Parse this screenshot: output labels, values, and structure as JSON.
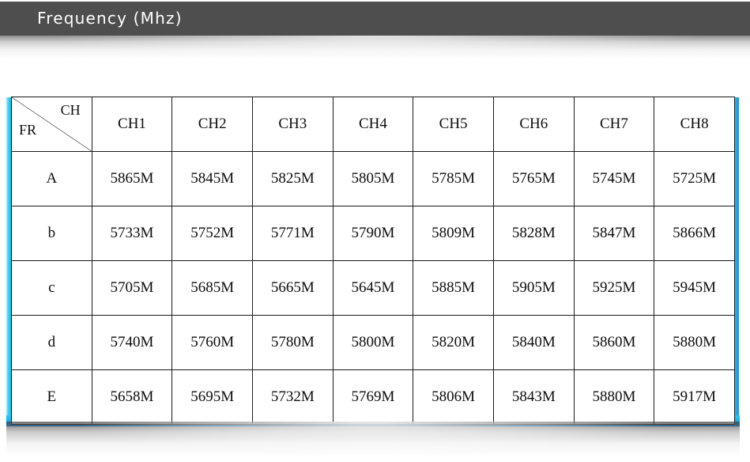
{
  "banner": {
    "title": "Frequency (Mhz)",
    "background_color": "#4e4e4e",
    "text_color": "#ffffff"
  },
  "table": {
    "corner": {
      "column_axis_label": "CH",
      "row_axis_label": "FR"
    },
    "column_headers": [
      "CH1",
      "CH2",
      "CH3",
      "CH4",
      "CH5",
      "CH6",
      "CH7",
      "CH8"
    ],
    "rows": [
      {
        "band": "A",
        "values": [
          "5865M",
          "5845M",
          "5825M",
          "5805M",
          "5785M",
          "5765M",
          "5745M",
          "5725M"
        ]
      },
      {
        "band": "b",
        "values": [
          "5733M",
          "5752M",
          "5771M",
          "5790M",
          "5809M",
          "5828M",
          "5847M",
          "5866M"
        ]
      },
      {
        "band": "c",
        "values": [
          "5705M",
          "5685M",
          "5665M",
          "5645M",
          "5885M",
          "5905M",
          "5925M",
          "5945M"
        ]
      },
      {
        "band": "d",
        "values": [
          "5740M",
          "5760M",
          "5780M",
          "5800M",
          "5820M",
          "5840M",
          "5860M",
          "5880M"
        ]
      },
      {
        "band": "E",
        "values": [
          "5658M",
          "5695M",
          "5732M",
          "5769M",
          "5806M",
          "5843M",
          "5880M",
          "5917M"
        ]
      }
    ]
  },
  "accents": {
    "glow_cyan": "#14b4ef",
    "glow_blue": "#1b86dc",
    "border_black": "#1a1a1a"
  }
}
